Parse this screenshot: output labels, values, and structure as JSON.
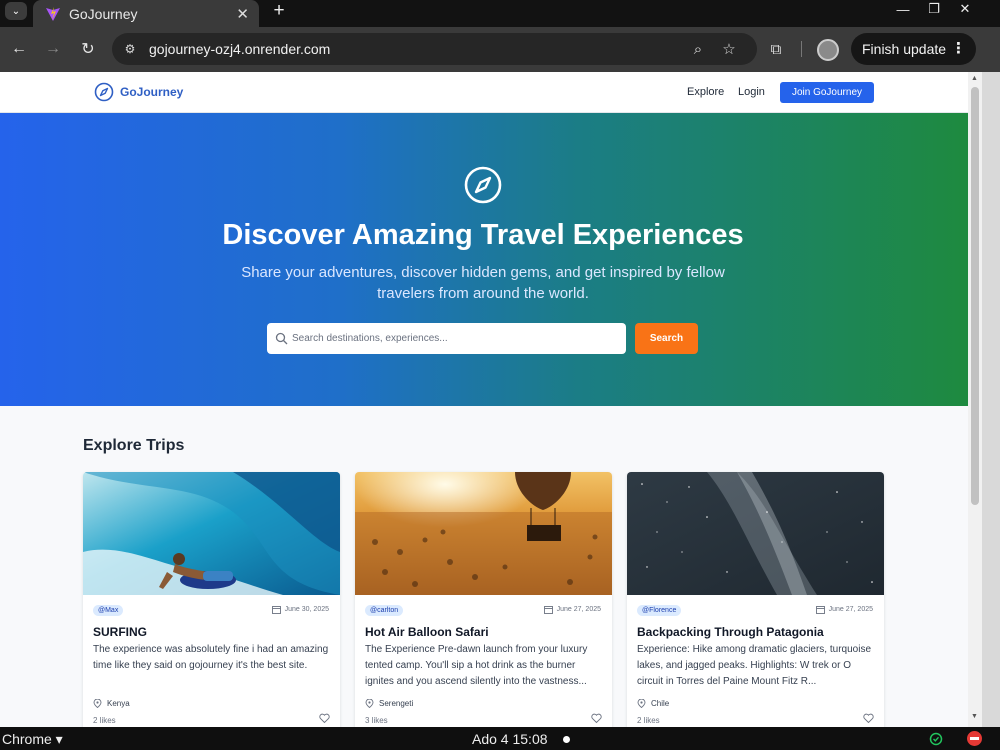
{
  "browser": {
    "tab_title": "GoJourney",
    "tab_close": "✕",
    "new_tab": "+",
    "url": "gojourney-ozj4.onrender.com",
    "finish_update": "Finish update",
    "window_controls": [
      "—",
      "❐",
      "✕"
    ]
  },
  "site": {
    "logo_text": "GoJourney",
    "nav": {
      "explore": "Explore",
      "login": "Login",
      "join": "Join GoJourney"
    },
    "hero": {
      "title": "Discover Amazing Travel Experiences",
      "subtitle": "Share your adventures, discover hidden gems, and get inspired by fellow travelers from around the world.",
      "search_placeholder": "Search destinations, experiences...",
      "search_button": "Search"
    },
    "explore": {
      "title": "Explore Trips",
      "cards": [
        {
          "user": "@Max",
          "date": "June 30, 2025",
          "title": "SURFING",
          "description": "The experience was absolutely fine i had an amazing time like they said on gojourney it's the best site.",
          "location": "Kenya",
          "likes": "2 likes"
        },
        {
          "user": "@carlton",
          "date": "June 27, 2025",
          "title": "Hot Air Balloon Safari",
          "description": "The Experience Pre-dawn launch from your luxury tented camp. You'll sip a hot drink as the burner ignites and you ascend silently into the vastness...",
          "location": "Serengeti",
          "likes": "3 likes"
        },
        {
          "user": "@Florence",
          "date": "June 27, 2025",
          "title": "Backpacking Through Patagonia",
          "description": "Experience: Hike among dramatic glaciers, turquoise lakes, and jagged peaks. Highlights: W trek or O circuit in Torres del Paine Mount Fitz R...",
          "location": "Chile",
          "likes": "2 likes"
        }
      ]
    }
  },
  "taskbar": {
    "app": "Chrome ▾",
    "clock": "Ado 4  15:08"
  },
  "colors": {
    "brand_blue": "#2563eb",
    "search_orange": "#f97316",
    "hero_gradient_end": "#1e8a3f"
  }
}
